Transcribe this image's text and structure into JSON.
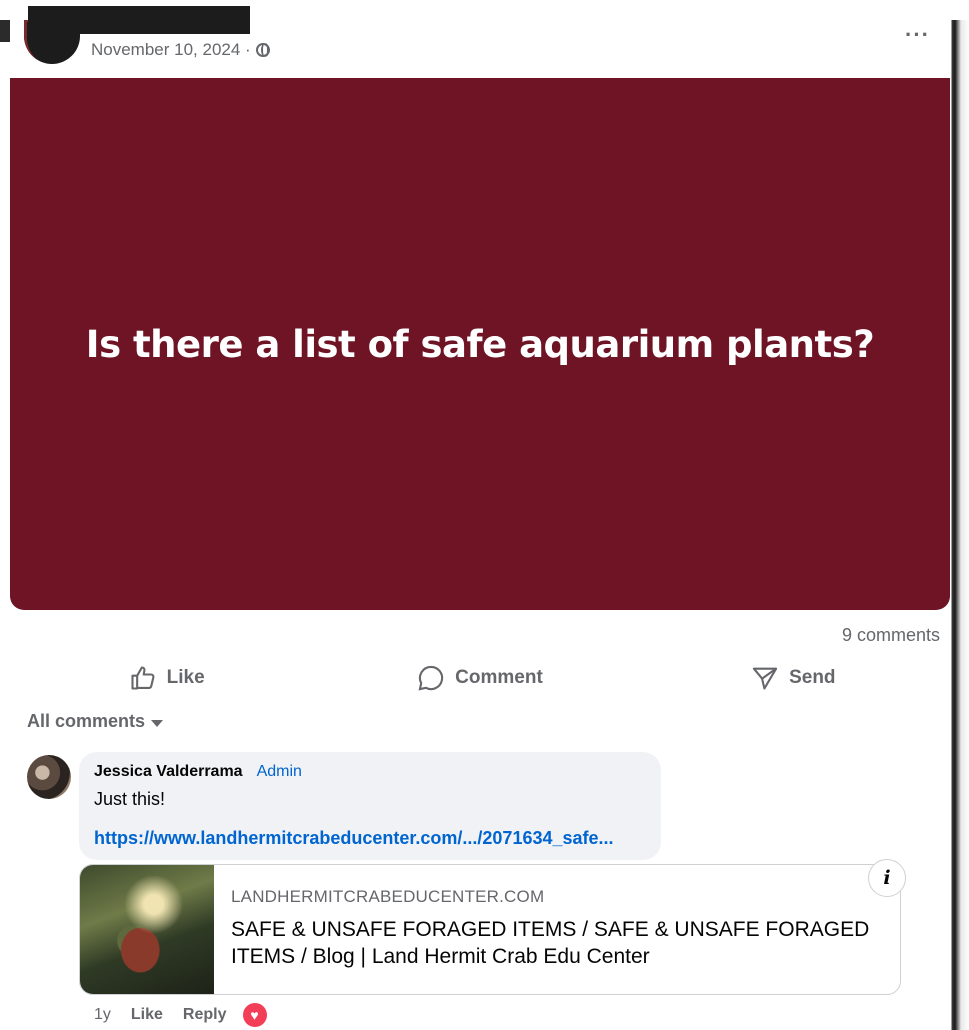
{
  "post": {
    "date": "November 10, 2024 ·",
    "more_label": "···",
    "text": "Is there a list of safe aquarium plants?",
    "background_color": "#6e1424",
    "comment_count": "9 comments"
  },
  "actions": {
    "like_label": "Like",
    "comment_label": "Comment",
    "send_label": "Send"
  },
  "comments_filter": "All comments",
  "comment": {
    "author": "Jessica Valderrama",
    "badge": "Admin",
    "text": "Just this!",
    "link_text": "https://www.landhermitcrabeducenter.com/.../2071634_safe...",
    "preview": {
      "domain": "LANDHERMITCRABEDUCENTER.COM",
      "title": "SAFE & UNSAFE FORAGED ITEMS / SAFE & UNSAFE FORAGED ITEMS / Blog | Land Hermit Crab Edu Center",
      "info_label": "i"
    },
    "time": "1y",
    "like_label": "Like",
    "reply_label": "Reply",
    "reaction": "heart-icon"
  },
  "colors": {
    "link": "#0064d1",
    "secondary_text": "#65676b",
    "reaction_heart": "#f33e58"
  }
}
